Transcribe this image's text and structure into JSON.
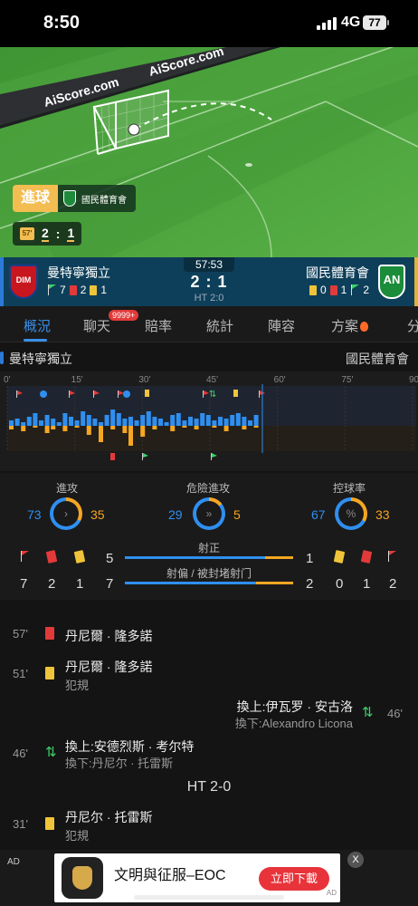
{
  "status_bar": {
    "time": "8:50",
    "network": "4G",
    "battery": "77"
  },
  "field": {
    "watermark_1": "AiScore.com",
    "watermark_2": "AiScore.com",
    "event_label": "進球",
    "event_team": "國民體育會",
    "minute": "57'",
    "score_home": "2",
    "score_sep": ":",
    "score_away": "1"
  },
  "match": {
    "clock": "57:53",
    "score": "2 : 1",
    "halftime": "HT 2:0",
    "home": {
      "name": "曼特寧獨立",
      "corners": "7",
      "red": "2",
      "yellow": "1",
      "crest": "DIM"
    },
    "away": {
      "name": "國民體育會",
      "yellow": "0",
      "red": "1",
      "corners": "2",
      "crest": "AN"
    }
  },
  "tabs": [
    {
      "label": "概況",
      "active": true
    },
    {
      "label": "聊天"
    },
    {
      "label": "賠率"
    },
    {
      "label": "統計"
    },
    {
      "label": "陣容"
    },
    {
      "label": "方案"
    },
    {
      "label": "分"
    }
  ],
  "chat_badge": "9999+",
  "team_row": {
    "home": "曼特寧獨立",
    "away": "國民體育會"
  },
  "timeline": {
    "ticks": [
      "0'",
      "15'",
      "30'",
      "45'",
      "60'",
      "75'",
      "90'"
    ]
  },
  "stats": {
    "attack": {
      "label": "進攻",
      "home": "73",
      "away": "35",
      "home_value": 73,
      "away_value": 35
    },
    "dangerous": {
      "label": "危險進攻",
      "home": "29",
      "away": "5",
      "home_value": 29,
      "away_value": 5
    },
    "possession": {
      "label": "控球率",
      "home": "67",
      "away": "33",
      "home_value": 67,
      "away_value": 33
    },
    "shots_on": {
      "label": "射正",
      "home": "5",
      "away": "1",
      "home_value": 5,
      "away_value": 1
    },
    "shots_off": {
      "label": "射偏 / 被封堵射门",
      "home": "7",
      "away": "2",
      "home_value": 7,
      "away_value": 2
    },
    "home_counts": {
      "corners": "7",
      "red": "2",
      "yellow": "1"
    },
    "away_counts": {
      "yellow": "0",
      "red": "1",
      "corners": "2"
    }
  },
  "events": [
    {
      "minute": "57'",
      "text": "丹尼爾 · 隆多諾",
      "type": "red"
    },
    {
      "minute": "51'",
      "text": "丹尼爾 · 隆多諾",
      "sub": "犯規",
      "type": "yellow"
    },
    {
      "minute": "46'",
      "text": "換上:伊瓦罗 · 安古洛",
      "sub": "換下:Alexandro Licona",
      "type": "sub",
      "side": "away"
    },
    {
      "minute": "46'",
      "text": "換上:安德烈斯 · 考尔特",
      "sub": "換下:丹尼尔 · 托雷斯",
      "type": "sub"
    },
    {
      "ht": "HT 2-0"
    },
    {
      "minute": "31'",
      "text": "丹尼尔 · 托雷斯",
      "sub": "犯規",
      "type": "yellow"
    }
  ],
  "ad": {
    "label": "AD",
    "title": "文明與征服–EOC",
    "button": "立即下載",
    "close": "X",
    "mark": "AD"
  }
}
